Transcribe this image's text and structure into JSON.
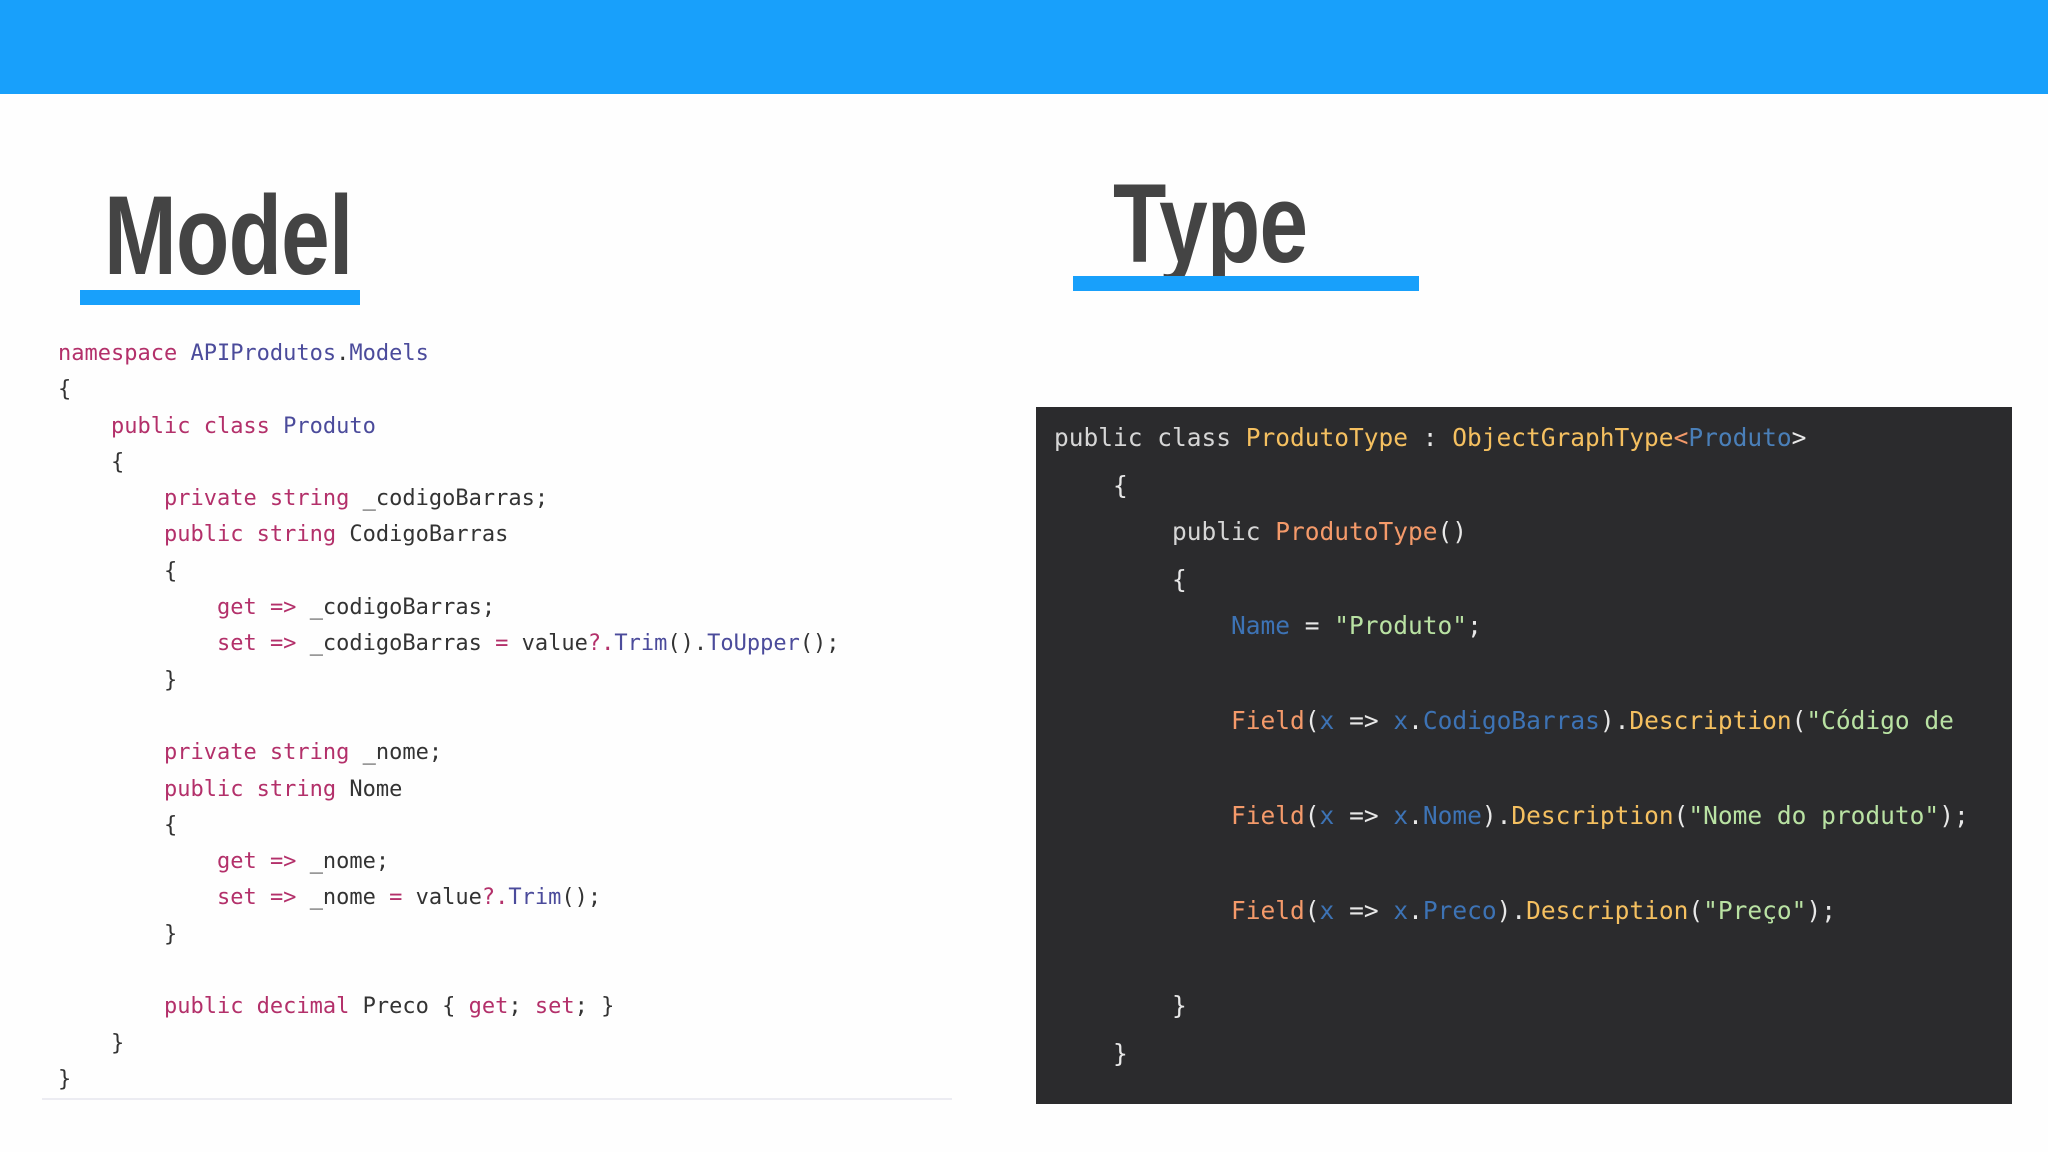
{
  "headings": {
    "model": "Model",
    "type": "Type"
  },
  "model_code": {
    "lines": [
      {
        "parts": [
          {
            "c": "k",
            "v": "namespace "
          },
          {
            "c": "t",
            "v": "APIProdutos"
          },
          {
            "c": "p",
            "v": "."
          },
          {
            "c": "t",
            "v": "Models"
          }
        ]
      },
      {
        "parts": [
          {
            "c": "p",
            "v": "{"
          }
        ]
      },
      {
        "parts": [
          {
            "c": "p",
            "v": "    "
          },
          {
            "c": "k",
            "v": "public class "
          },
          {
            "c": "t",
            "v": "Produto"
          }
        ]
      },
      {
        "parts": [
          {
            "c": "p",
            "v": "    {"
          }
        ]
      },
      {
        "parts": [
          {
            "c": "p",
            "v": "        "
          },
          {
            "c": "k",
            "v": "private string "
          },
          {
            "c": "p",
            "v": "_codigoBarras;"
          }
        ]
      },
      {
        "parts": [
          {
            "c": "p",
            "v": "        "
          },
          {
            "c": "k",
            "v": "public string "
          },
          {
            "c": "p",
            "v": "CodigoBarras"
          }
        ]
      },
      {
        "parts": [
          {
            "c": "p",
            "v": "        {"
          }
        ]
      },
      {
        "parts": [
          {
            "c": "p",
            "v": "            "
          },
          {
            "c": "k",
            "v": "get "
          },
          {
            "c": "o",
            "v": "=> "
          },
          {
            "c": "p",
            "v": "_codigoBarras;"
          }
        ]
      },
      {
        "parts": [
          {
            "c": "p",
            "v": "            "
          },
          {
            "c": "k",
            "v": "set "
          },
          {
            "c": "o",
            "v": "=> "
          },
          {
            "c": "p",
            "v": "_codigoBarras "
          },
          {
            "c": "o",
            "v": "= "
          },
          {
            "c": "p",
            "v": "value"
          },
          {
            "c": "o",
            "v": "?."
          },
          {
            "c": "m",
            "v": "Trim"
          },
          {
            "c": "p",
            "v": "()."
          },
          {
            "c": "m",
            "v": "ToUpper"
          },
          {
            "c": "p",
            "v": "();"
          }
        ]
      },
      {
        "parts": [
          {
            "c": "p",
            "v": "        }"
          }
        ]
      },
      {
        "parts": [
          {
            "c": "p",
            "v": " "
          }
        ]
      },
      {
        "parts": [
          {
            "c": "p",
            "v": "        "
          },
          {
            "c": "k",
            "v": "private string "
          },
          {
            "c": "p",
            "v": "_nome;"
          }
        ]
      },
      {
        "parts": [
          {
            "c": "p",
            "v": "        "
          },
          {
            "c": "k",
            "v": "public string "
          },
          {
            "c": "p",
            "v": "Nome"
          }
        ]
      },
      {
        "parts": [
          {
            "c": "p",
            "v": "        {"
          }
        ]
      },
      {
        "parts": [
          {
            "c": "p",
            "v": "            "
          },
          {
            "c": "k",
            "v": "get "
          },
          {
            "c": "o",
            "v": "=> "
          },
          {
            "c": "p",
            "v": "_nome;"
          }
        ]
      },
      {
        "parts": [
          {
            "c": "p",
            "v": "            "
          },
          {
            "c": "k",
            "v": "set "
          },
          {
            "c": "o",
            "v": "=> "
          },
          {
            "c": "p",
            "v": "_nome "
          },
          {
            "c": "o",
            "v": "= "
          },
          {
            "c": "p",
            "v": "value"
          },
          {
            "c": "o",
            "v": "?."
          },
          {
            "c": "m",
            "v": "Trim"
          },
          {
            "c": "p",
            "v": "();"
          }
        ]
      },
      {
        "parts": [
          {
            "c": "p",
            "v": "        }"
          }
        ]
      },
      {
        "parts": [
          {
            "c": "p",
            "v": " "
          }
        ]
      },
      {
        "parts": [
          {
            "c": "p",
            "v": "        "
          },
          {
            "c": "k",
            "v": "public decimal "
          },
          {
            "c": "p",
            "v": "Preco { "
          },
          {
            "c": "k",
            "v": "get"
          },
          {
            "c": "p",
            "v": "; "
          },
          {
            "c": "k",
            "v": "set"
          },
          {
            "c": "p",
            "v": "; }"
          }
        ]
      },
      {
        "parts": [
          {
            "c": "p",
            "v": "    }"
          }
        ]
      },
      {
        "parts": [
          {
            "c": "p",
            "v": "}"
          }
        ]
      }
    ]
  },
  "type_code": {
    "lines": [
      {
        "parts": [
          {
            "c": "kw",
            "v": "public class "
          },
          {
            "c": "cls",
            "v": "ProdutoType "
          },
          {
            "c": "pun",
            "v": ": "
          },
          {
            "c": "cls",
            "v": "ObjectGraphType"
          },
          {
            "c": "fn",
            "v": "<"
          },
          {
            "c": "gen",
            "v": "Produto"
          },
          {
            "c": "pun",
            "v": ">"
          }
        ]
      },
      {
        "parts": [
          {
            "c": "pun",
            "v": "    {"
          }
        ]
      },
      {
        "parts": [
          {
            "c": "pun",
            "v": "        "
          },
          {
            "c": "kw",
            "v": "public "
          },
          {
            "c": "fn",
            "v": "ProdutoType"
          },
          {
            "c": "pun",
            "v": "()"
          }
        ]
      },
      {
        "parts": [
          {
            "c": "pun",
            "v": "        {"
          }
        ]
      },
      {
        "parts": [
          {
            "c": "pun",
            "v": "            "
          },
          {
            "c": "prop",
            "v": "Name "
          },
          {
            "c": "pun",
            "v": "= "
          },
          {
            "c": "str",
            "v": "\"Produto\""
          },
          {
            "c": "pun",
            "v": ";"
          }
        ]
      },
      {
        "parts": [
          {
            "c": "pun",
            "v": "            "
          },
          {
            "c": "fn",
            "v": "Field"
          },
          {
            "c": "pun",
            "v": "("
          },
          {
            "c": "prop",
            "v": "x "
          },
          {
            "c": "pun",
            "v": "=> "
          },
          {
            "c": "prop",
            "v": "x"
          },
          {
            "c": "pun",
            "v": "."
          },
          {
            "c": "prop",
            "v": "CodigoBarras"
          },
          {
            "c": "pun",
            "v": ")."
          },
          {
            "c": "meth",
            "v": "Description"
          },
          {
            "c": "pun",
            "v": "("
          },
          {
            "c": "str",
            "v": "\"Código de"
          }
        ]
      },
      {
        "parts": [
          {
            "c": "pun",
            "v": "            "
          },
          {
            "c": "fn",
            "v": "Field"
          },
          {
            "c": "pun",
            "v": "("
          },
          {
            "c": "prop",
            "v": "x "
          },
          {
            "c": "pun",
            "v": "=> "
          },
          {
            "c": "prop",
            "v": "x"
          },
          {
            "c": "pun",
            "v": "."
          },
          {
            "c": "prop",
            "v": "Nome"
          },
          {
            "c": "pun",
            "v": ")."
          },
          {
            "c": "meth",
            "v": "Description"
          },
          {
            "c": "pun",
            "v": "("
          },
          {
            "c": "str",
            "v": "\"Nome do produto\""
          },
          {
            "c": "pun",
            "v": ");"
          }
        ]
      },
      {
        "parts": [
          {
            "c": "pun",
            "v": "            "
          },
          {
            "c": "fn",
            "v": "Field"
          },
          {
            "c": "pun",
            "v": "("
          },
          {
            "c": "prop",
            "v": "x "
          },
          {
            "c": "pun",
            "v": "=> "
          },
          {
            "c": "prop",
            "v": "x"
          },
          {
            "c": "pun",
            "v": "."
          },
          {
            "c": "prop",
            "v": "Preco"
          },
          {
            "c": "pun",
            "v": ")."
          },
          {
            "c": "meth",
            "v": "Description"
          },
          {
            "c": "pun",
            "v": "("
          },
          {
            "c": "str",
            "v": "\"Preço\""
          },
          {
            "c": "pun",
            "v": ");"
          }
        ]
      },
      {
        "parts": [
          {
            "c": "pun",
            "v": "        }"
          }
        ]
      },
      {
        "parts": [
          {
            "c": "pun",
            "v": "    }"
          }
        ]
      }
    ]
  },
  "colors": {
    "top_bar": "#18a0fb",
    "underline": "#18a0fb",
    "dark_panel": "#2b2b2d"
  }
}
